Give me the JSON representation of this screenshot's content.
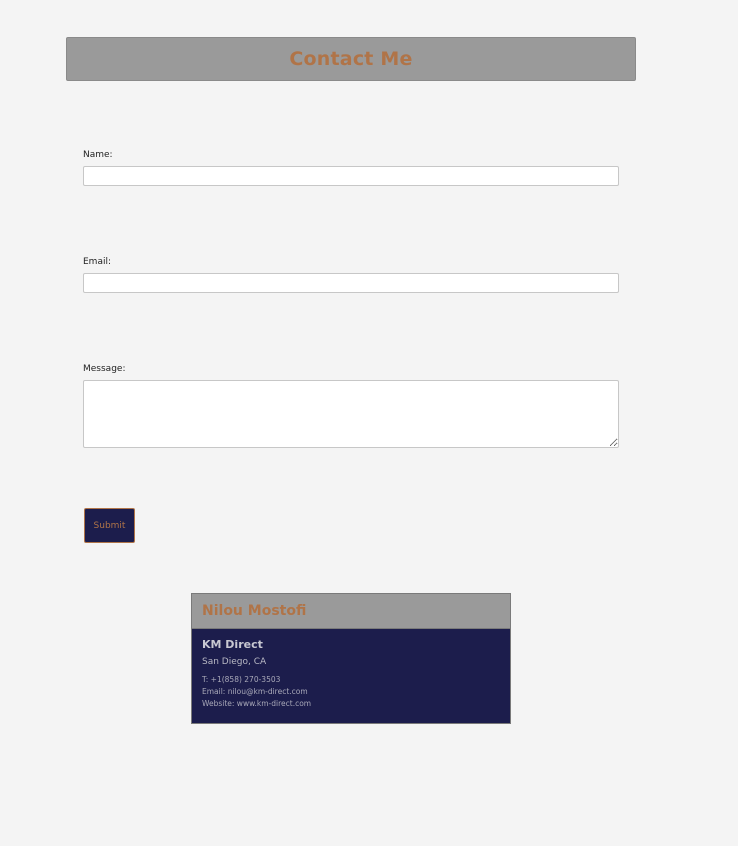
{
  "header": {
    "title": "Contact Me"
  },
  "form": {
    "name_label": "Name:",
    "name_value": "",
    "email_label": "Email:",
    "email_value": "",
    "message_label": "Message:",
    "message_value": "",
    "submit_label": "Submit"
  },
  "card": {
    "name": "Nilou Mostofi",
    "company": "KM Direct",
    "location": "San Diego, CA",
    "phone": "T: +1(858) 270-3503",
    "email": "Email: nilou@km-direct.com",
    "website": "Website: www.km-direct.com"
  },
  "colors": {
    "background": "#f4f4f4",
    "header_bar": "#9a9a9a",
    "accent": "#b07448",
    "navy": "#1c1d4c"
  }
}
